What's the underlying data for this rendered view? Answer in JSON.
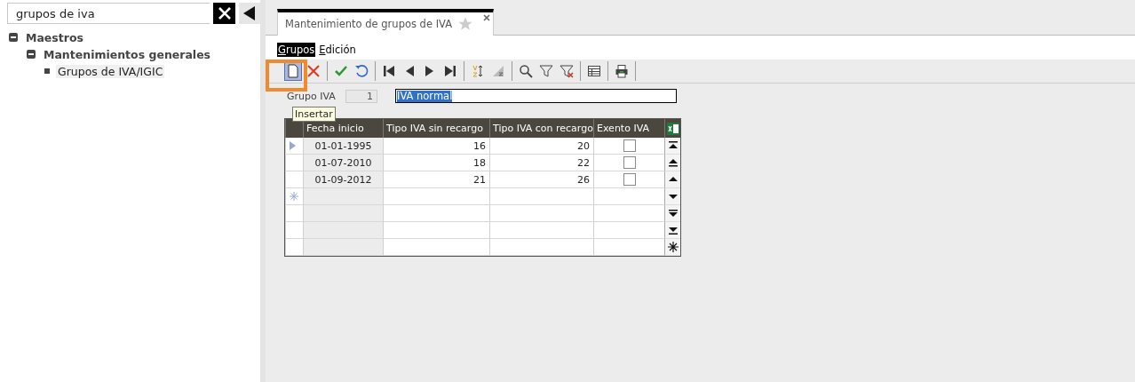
{
  "search": {
    "value": "grupos de iva"
  },
  "tree": [
    {
      "label": "Maestros",
      "expanded": true,
      "children": [
        {
          "label": "Mantenimientos generales",
          "expanded": true,
          "children": [
            {
              "label": "Grupos de IVA/IGIC",
              "selected": true
            }
          ]
        }
      ]
    }
  ],
  "tab": {
    "title": "Mantenimiento de grupos de IVA",
    "selected": true,
    "favorite": false
  },
  "menu": [
    {
      "label": "Grupos",
      "selected": true
    },
    {
      "label": "Edición",
      "selected": false
    }
  ],
  "toolbar": {
    "tools": [
      {
        "kind": "new",
        "highlighted": true
      },
      {
        "kind": "delete",
        "highlighted": false
      },
      {
        "kind": "sep"
      },
      {
        "kind": "accept",
        "highlighted": false
      },
      {
        "kind": "undo",
        "highlighted": false
      },
      {
        "kind": "sep"
      },
      {
        "kind": "first",
        "highlighted": false
      },
      {
        "kind": "prev",
        "highlighted": false
      },
      {
        "kind": "next",
        "highlighted": false
      },
      {
        "kind": "last",
        "highlighted": false
      },
      {
        "kind": "sep"
      },
      {
        "kind": "sort",
        "highlighted": false
      },
      {
        "kind": "unsort",
        "highlighted": false
      },
      {
        "kind": "sep"
      },
      {
        "kind": "search",
        "highlighted": false
      },
      {
        "kind": "filter",
        "highlighted": false
      },
      {
        "kind": "unfilter",
        "highlighted": false
      },
      {
        "kind": "sep"
      },
      {
        "kind": "grid",
        "highlighted": false
      },
      {
        "kind": "sep"
      },
      {
        "kind": "print",
        "highlighted": false
      },
      {
        "kind": "sep"
      }
    ],
    "tooltip": "Insertar"
  },
  "form": {
    "label": "Grupo IVA",
    "code": "1",
    "name": "IVA normal"
  },
  "grid": {
    "columns": [
      "Fecha inicio",
      "Tipo IVA sin recargo",
      "Tipo IVA con recargo",
      "Exento IVA"
    ],
    "rows": [
      {
        "current": true,
        "date": "01-01-1995",
        "without": "16",
        "with": "20",
        "exempt": false
      },
      {
        "current": false,
        "date": "01-07-2010",
        "without": "18",
        "with": "22",
        "exempt": false
      },
      {
        "current": false,
        "date": "01-09-2012",
        "without": "21",
        "with": "26",
        "exempt": false
      }
    ]
  }
}
